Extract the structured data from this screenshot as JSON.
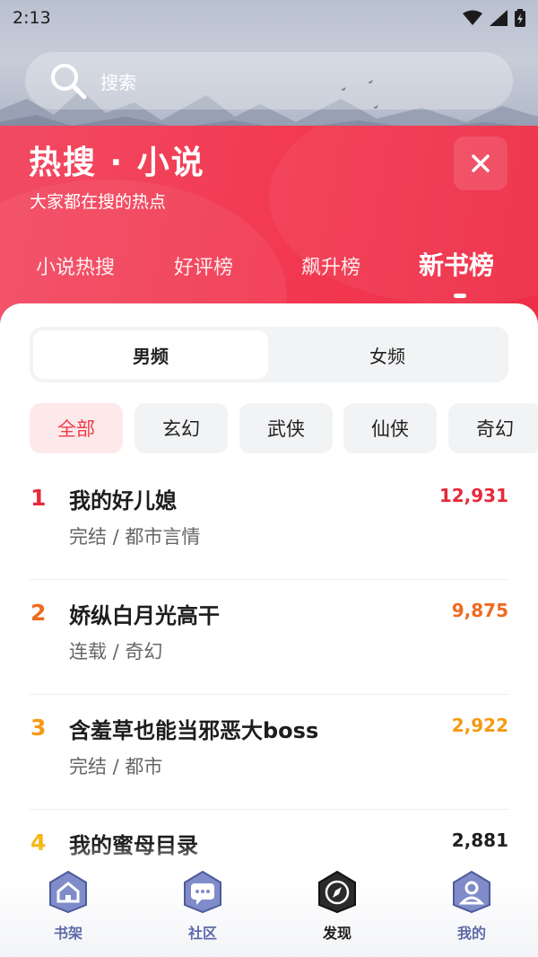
{
  "status_bar": {
    "time": "2:13"
  },
  "search": {
    "placeholder": "搜索"
  },
  "hot": {
    "title": "热搜 · 小说",
    "subtitle": "大家都在搜的热点",
    "tabs": [
      {
        "label": "小说热搜",
        "active": false
      },
      {
        "label": "好评榜",
        "active": false
      },
      {
        "label": "飙升榜",
        "active": false
      },
      {
        "label": "新书榜",
        "active": true
      }
    ]
  },
  "gender_tabs": [
    {
      "label": "男频",
      "active": true
    },
    {
      "label": "女频",
      "active": false
    }
  ],
  "categories": [
    {
      "label": "全部",
      "active": true
    },
    {
      "label": "玄幻",
      "active": false
    },
    {
      "label": "武侠",
      "active": false
    },
    {
      "label": "仙侠",
      "active": false
    },
    {
      "label": "奇幻",
      "active": false
    }
  ],
  "ranking": [
    {
      "rank": "1",
      "title": "我的好儿媳",
      "meta": "完结 / 都市言情",
      "score": "12,931",
      "color": "#e8293b"
    },
    {
      "rank": "2",
      "title": "娇纵白月光高干",
      "meta": "连载 / 奇幻",
      "score": "9,875",
      "color": "#f06a1e"
    },
    {
      "rank": "3",
      "title": "含羞草也能当邪恶大boss",
      "meta": "完结 / 都市",
      "score": "2,922",
      "color": "#f59a12"
    },
    {
      "rank": "4",
      "title": "我的蜜母目录",
      "meta": "",
      "score": "2,881",
      "color": "#f5b70f"
    }
  ],
  "bottom_nav": [
    {
      "label": "书架",
      "icon": "home-icon",
      "active": false
    },
    {
      "label": "社区",
      "icon": "chat-icon",
      "active": false
    },
    {
      "label": "发现",
      "icon": "compass-icon",
      "active": true
    },
    {
      "label": "我的",
      "icon": "user-icon",
      "active": false
    }
  ],
  "colors": {
    "accent_red": "#ef3b4a",
    "header_gradient_start": "#f24a63",
    "nav_inactive": "#5e6aa8"
  }
}
